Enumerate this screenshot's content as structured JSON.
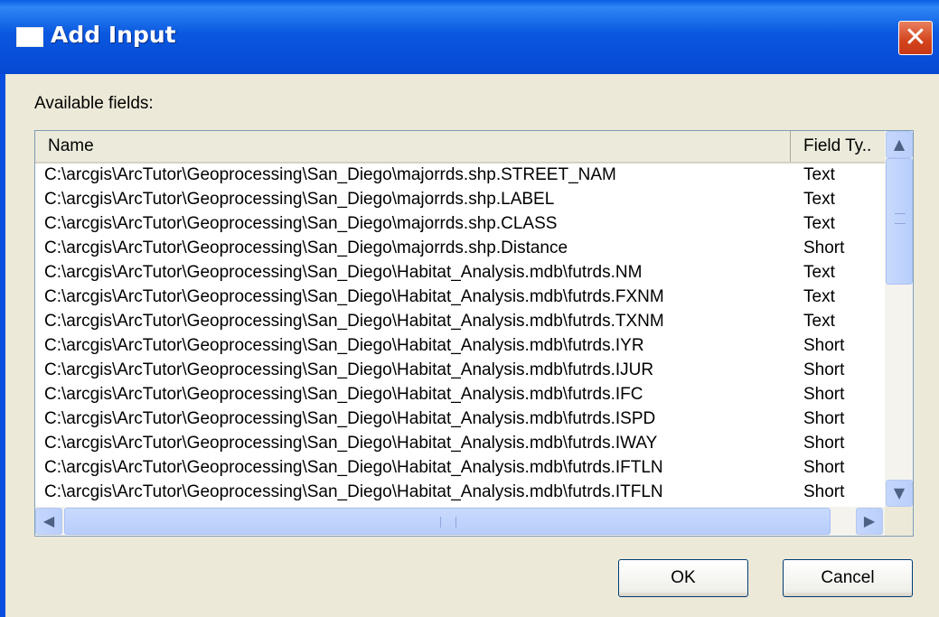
{
  "window": {
    "title": "Add Input",
    "close_glyph": "✕",
    "title_icon": "window-icon"
  },
  "fields_label": "Available fields:",
  "table": {
    "columns": [
      "Name",
      "Field Ty.."
    ],
    "rows": [
      {
        "name": "C:\\arcgis\\ArcTutor\\Geoprocessing\\San_Diego\\majorrds.shp.STREET_NAM",
        "type": "Text"
      },
      {
        "name": "C:\\arcgis\\ArcTutor\\Geoprocessing\\San_Diego\\majorrds.shp.LABEL",
        "type": "Text"
      },
      {
        "name": "C:\\arcgis\\ArcTutor\\Geoprocessing\\San_Diego\\majorrds.shp.CLASS",
        "type": "Text"
      },
      {
        "name": "C:\\arcgis\\ArcTutor\\Geoprocessing\\San_Diego\\majorrds.shp.Distance",
        "type": "Short"
      },
      {
        "name": "C:\\arcgis\\ArcTutor\\Geoprocessing\\San_Diego\\Habitat_Analysis.mdb\\futrds.NM",
        "type": "Text"
      },
      {
        "name": "C:\\arcgis\\ArcTutor\\Geoprocessing\\San_Diego\\Habitat_Analysis.mdb\\futrds.FXNM",
        "type": "Text"
      },
      {
        "name": "C:\\arcgis\\ArcTutor\\Geoprocessing\\San_Diego\\Habitat_Analysis.mdb\\futrds.TXNM",
        "type": "Text"
      },
      {
        "name": "C:\\arcgis\\ArcTutor\\Geoprocessing\\San_Diego\\Habitat_Analysis.mdb\\futrds.IYR",
        "type": "Short"
      },
      {
        "name": "C:\\arcgis\\ArcTutor\\Geoprocessing\\San_Diego\\Habitat_Analysis.mdb\\futrds.IJUR",
        "type": "Short"
      },
      {
        "name": "C:\\arcgis\\ArcTutor\\Geoprocessing\\San_Diego\\Habitat_Analysis.mdb\\futrds.IFC",
        "type": "Short"
      },
      {
        "name": "C:\\arcgis\\ArcTutor\\Geoprocessing\\San_Diego\\Habitat_Analysis.mdb\\futrds.ISPD",
        "type": "Short"
      },
      {
        "name": "C:\\arcgis\\ArcTutor\\Geoprocessing\\San_Diego\\Habitat_Analysis.mdb\\futrds.IWAY",
        "type": "Short"
      },
      {
        "name": "C:\\arcgis\\ArcTutor\\Geoprocessing\\San_Diego\\Habitat_Analysis.mdb\\futrds.IFTLN",
        "type": "Short"
      },
      {
        "name": "C:\\arcgis\\ArcTutor\\Geoprocessing\\San_Diego\\Habitat_Analysis.mdb\\futrds.ITFLN",
        "type": "Short"
      }
    ]
  },
  "scrollbar": {
    "up_arrow": "▲",
    "down_arrow": "▼",
    "left_arrow": "◀",
    "right_arrow": "▶"
  },
  "buttons": {
    "ok": "OK",
    "cancel": "Cancel"
  },
  "colors": {
    "titlebar": "#0a58e0",
    "client": "#ece9d8",
    "close": "#d3431c"
  }
}
